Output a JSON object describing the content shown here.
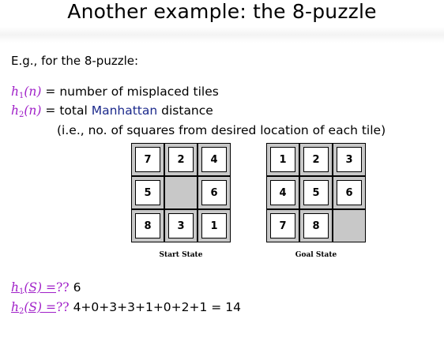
{
  "title": "Another example: the 8-puzzle",
  "intro": "E.g., for the 8-puzzle:",
  "h1_label": "h",
  "h1_sub": "1",
  "h1_arg": "(n)",
  "h1_text": "number of misplaced tiles",
  "h2_label": "h",
  "h2_sub": "2",
  "h2_arg": "(n)",
  "h2_text_before": "total",
  "h2_text_manhattan": "Manhattan",
  "h2_text_after": "distance",
  "ie_text": "(i.e., no. of squares from desired location of each tile)",
  "start_board": [
    "7",
    "2",
    "4",
    "5",
    "",
    "6",
    "8",
    "3",
    "1"
  ],
  "goal_board": [
    "1",
    "2",
    "3",
    "4",
    "5",
    "6",
    "7",
    "8",
    ""
  ],
  "start_caption": "Start State",
  "goal_caption": "Goal State",
  "answer1_lhs": "h",
  "answer1_sub": "1",
  "answer1_arg": "(S) =",
  "answer1_q": "??",
  "answer1_val": "6",
  "answer2_lhs": "h",
  "answer2_sub": "2",
  "answer2_arg": "(S) =",
  "answer2_q": "??",
  "answer2_expr": "4+0+3+3+1+0+2+1 = 14",
  "colors": {
    "math": "#a020c8",
    "manhattan": "#1c2a8c",
    "board_gray": "#c8c8c8"
  }
}
